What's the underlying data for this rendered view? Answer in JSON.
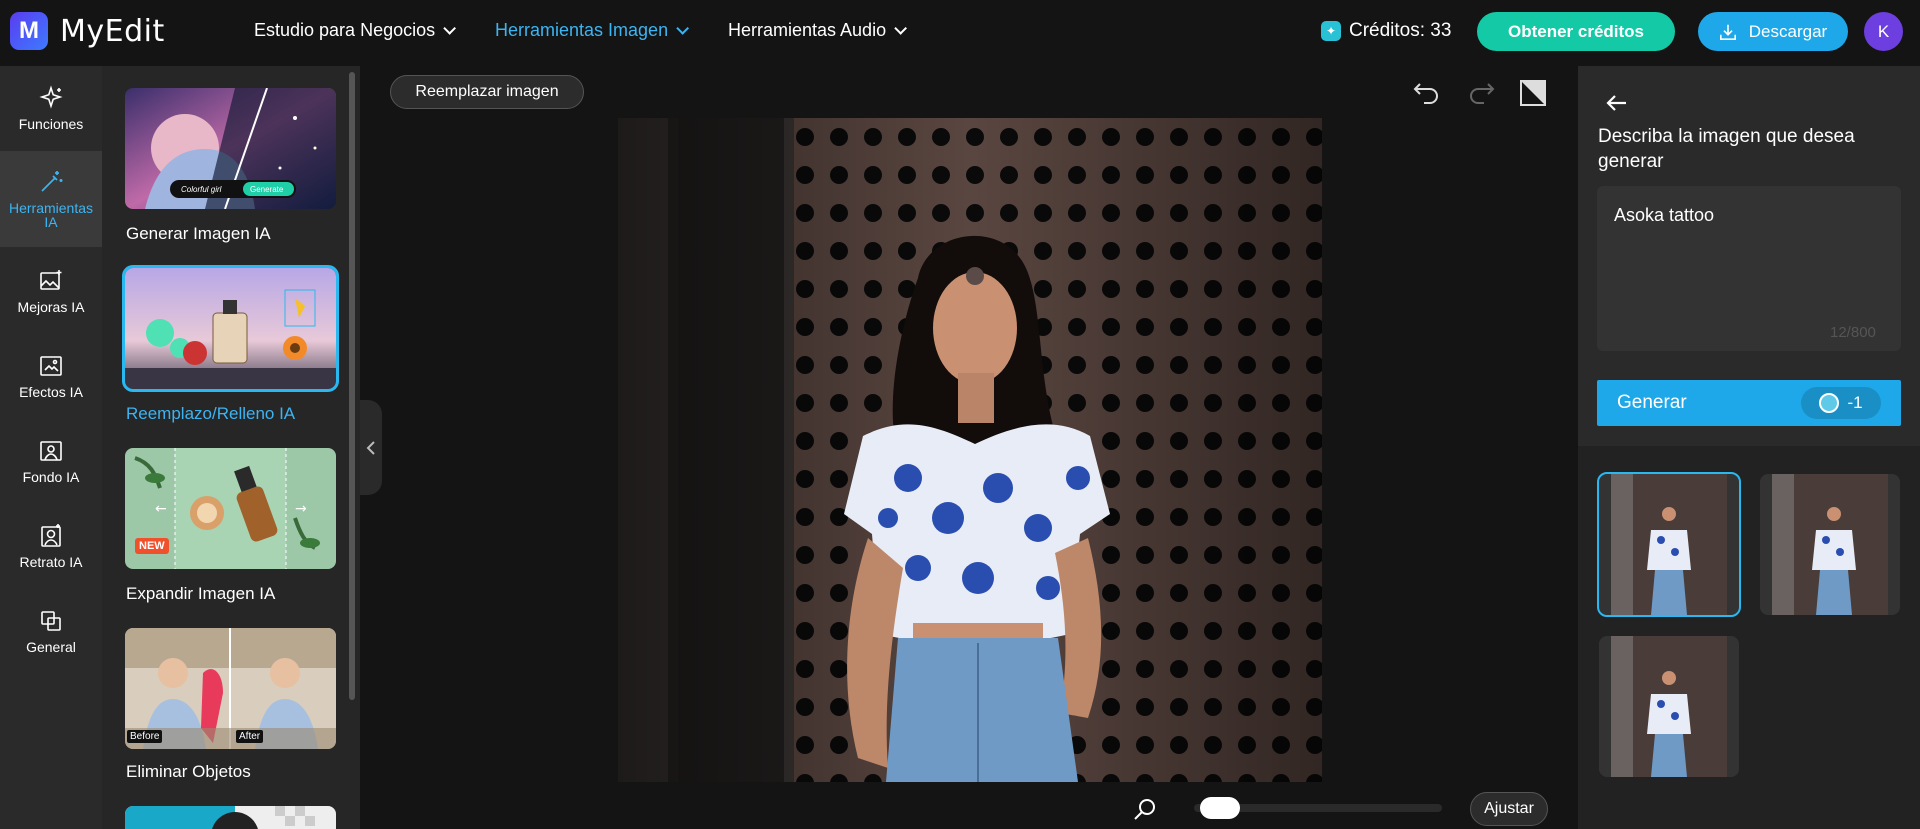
{
  "app": {
    "name": "MyEdit",
    "logo_letter": "M"
  },
  "nav": [
    {
      "label": "Estudio para Negocios",
      "active": false
    },
    {
      "label": "Herramientas Imagen",
      "active": true
    },
    {
      "label": "Herramientas Audio",
      "active": false
    }
  ],
  "header": {
    "credits_label": "Créditos: 33",
    "obtain_label": "Obtener créditos",
    "download_label": "Descargar",
    "avatar_initial": "K"
  },
  "sidebar": {
    "items": [
      {
        "label": "Funciones",
        "icon": "sparkle-icon"
      },
      {
        "label": "Herramientas IA",
        "icon": "magic-wand-icon",
        "active": true
      },
      {
        "label": "Mejoras IA",
        "icon": "image-enhance-icon"
      },
      {
        "label": "Efectos IA",
        "icon": "effects-icon"
      },
      {
        "label": "Fondo IA",
        "icon": "background-icon"
      },
      {
        "label": "Retrato IA",
        "icon": "portrait-icon"
      },
      {
        "label": "General",
        "icon": "layers-icon"
      }
    ]
  },
  "tools": [
    {
      "label": "Generar Imagen IA",
      "pill_text": "Colorful girl",
      "pill_button": "Generate"
    },
    {
      "label": "Reemplazo/Relleno IA",
      "active": true
    },
    {
      "label": "Expandir Imagen IA",
      "badge": "NEW"
    },
    {
      "label": "Eliminar Objetos",
      "before": "Before",
      "after": "After"
    }
  ],
  "canvas": {
    "replace_label": "Reemplazar imagen",
    "fit_label": "Ajustar",
    "zoom_level": 0.05
  },
  "right_panel": {
    "prompt_label": "Describa la imagen que desea generar",
    "prompt_value": "Asoka tattoo",
    "prompt_count": "12/800",
    "generate_label": "Generar",
    "generate_cost": "-1"
  },
  "colors": {
    "accent": "#1ea8ea",
    "active_text": "#3db4f2",
    "obtain": "#14c9a6",
    "avatar": "#6d3fe0"
  }
}
